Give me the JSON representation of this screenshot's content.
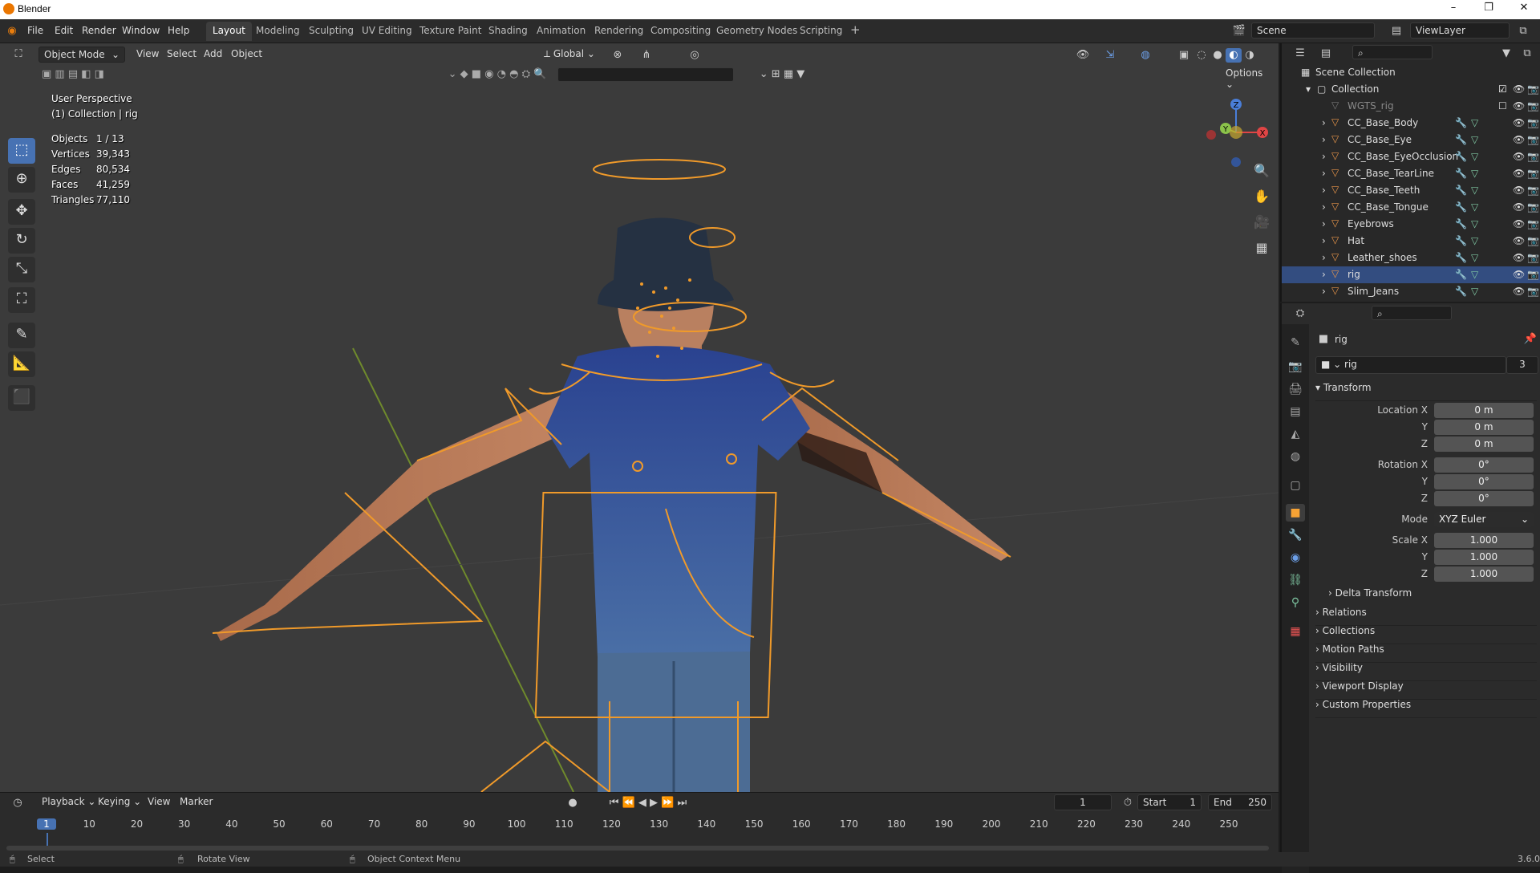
{
  "app": {
    "title": "Blender",
    "version": "3.6"
  },
  "menu": [
    "File",
    "Edit",
    "Render",
    "Window",
    "Help"
  ],
  "workspaces": [
    "Layout",
    "Modeling",
    "Sculpting",
    "UV Editing",
    "Texture Paint",
    "Shading",
    "Animation",
    "Rendering",
    "Compositing",
    "Geometry Nodes",
    "Scripting"
  ],
  "active_workspace": "Layout",
  "scene": {
    "name": "Scene",
    "view_layer": "ViewLayer"
  },
  "viewport": {
    "mode": "Object Mode",
    "menus": [
      "View",
      "Select",
      "Add",
      "Object"
    ],
    "orientation": "Global",
    "options_label": "Options",
    "overlay_title": "User Perspective",
    "overlay_subtitle": "(1) Collection | rig",
    "stats": [
      {
        "label": "Objects",
        "value": "1 / 13"
      },
      {
        "label": "Vertices",
        "value": "39,343"
      },
      {
        "label": "Edges",
        "value": "80,534"
      },
      {
        "label": "Faces",
        "value": "41,259"
      },
      {
        "label": "Triangles",
        "value": "77,110"
      }
    ],
    "gizmo": {
      "x": "X",
      "y": "Y",
      "z": "Z"
    }
  },
  "outliner": {
    "root": "Scene Collection",
    "collection": "Collection",
    "items": [
      {
        "name": "WGTS_rig",
        "dim": true
      },
      {
        "name": "CC_Base_Body"
      },
      {
        "name": "CC_Base_Eye"
      },
      {
        "name": "CC_Base_EyeOcclusion"
      },
      {
        "name": "CC_Base_TearLine"
      },
      {
        "name": "CC_Base_Teeth"
      },
      {
        "name": "CC_Base_Tongue"
      },
      {
        "name": "Eyebrows"
      },
      {
        "name": "Hat"
      },
      {
        "name": "Leather_shoes"
      },
      {
        "name": "rig",
        "selected": true
      },
      {
        "name": "Slim_Jeans"
      }
    ]
  },
  "properties": {
    "object_name": "rig",
    "datablock_name": "rig",
    "users": "3",
    "transform_label": "Transform",
    "location": {
      "label": "Location X",
      "x": "0 m",
      "y": "0 m",
      "z": "0 m"
    },
    "rotation": {
      "label": "Rotation X",
      "x": "0°",
      "y": "0°",
      "z": "0°"
    },
    "mode_label": "Mode",
    "mode_value": "XYZ Euler",
    "scale": {
      "label": "Scale X",
      "x": "1.000",
      "y": "1.000",
      "z": "1.000"
    },
    "axis_y": "Y",
    "axis_z": "Z",
    "panels": [
      "Delta Transform",
      "Relations",
      "Collections",
      "Motion Paths",
      "Visibility",
      "Viewport Display",
      "Custom Properties"
    ]
  },
  "timeline": {
    "menus": [
      "Playback",
      "Keying",
      "View",
      "Marker"
    ],
    "current_frame": "1",
    "start_label": "Start",
    "start": "1",
    "end_label": "End",
    "end": "250",
    "ticks": [
      "1",
      "10",
      "20",
      "30",
      "40",
      "50",
      "60",
      "70",
      "80",
      "90",
      "100",
      "110",
      "120",
      "130",
      "140",
      "150",
      "160",
      "170",
      "180",
      "190",
      "200",
      "210",
      "220",
      "230",
      "240",
      "250"
    ]
  },
  "statusbar": {
    "select": "Select",
    "rotate": "Rotate View",
    "context": "Object Context Menu",
    "version": "3.6.0"
  },
  "colors": {
    "accent": "#4772b3",
    "rig": "#f09a2a",
    "selection": "#334d80",
    "shirt": "#2d4c8a"
  }
}
